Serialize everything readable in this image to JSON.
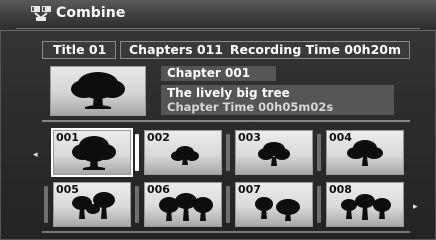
{
  "header": {
    "title": "Combine",
    "icon": "combine-icon"
  },
  "info": {
    "title_label": "Title 01",
    "chapters_label": "Chapters 011",
    "recording_time": "Recording Time  00h20m"
  },
  "current": {
    "chapter": "Chapter 001",
    "name": "The lively big tree",
    "chapter_time": "Chapter Time  00h05m02s"
  },
  "thumbnails": [
    {
      "number": "001",
      "selected": true
    },
    {
      "number": "002"
    },
    {
      "number": "003"
    },
    {
      "number": "004"
    },
    {
      "number": "005"
    },
    {
      "number": "006"
    },
    {
      "number": "007"
    },
    {
      "number": "008"
    }
  ],
  "nav": {
    "left_arrow": "◂",
    "right_arrow": "▸"
  }
}
